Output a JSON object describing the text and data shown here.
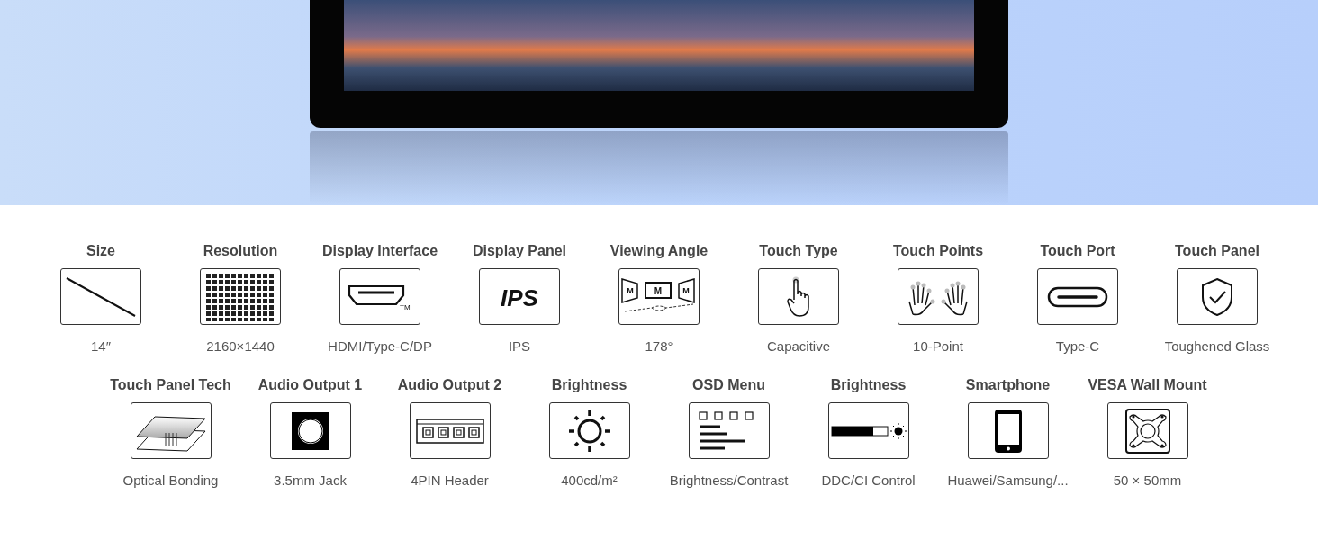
{
  "spec_rows": [
    [
      {
        "title": "Size",
        "value": "14″",
        "kind": "diagonal"
      },
      {
        "title": "Resolution",
        "value": "2160×1440",
        "kind": "pixel-grid"
      },
      {
        "title": "Display Interface",
        "value": "HDMI/Type-C/DP",
        "kind": "hdmi",
        "icon_text": "TM"
      },
      {
        "title": "Display Panel",
        "value": "IPS",
        "kind": "panel-text",
        "icon_text": "IPS"
      },
      {
        "title": "Viewing Angle",
        "value": "178°",
        "kind": "viewing",
        "icon_labels": [
          "M",
          "M",
          "M"
        ]
      },
      {
        "title": "Touch Type",
        "value": "Capacitive",
        "kind": "finger"
      },
      {
        "title": "Touch Points",
        "value": "10-Point",
        "kind": "hands"
      },
      {
        "title": "Touch Port",
        "value": "Type-C",
        "kind": "usbc"
      },
      {
        "title": "Touch Panel",
        "value": "Toughened Glass",
        "kind": "shield"
      }
    ],
    [
      {
        "title": "Touch Panel Tech",
        "value": "Optical Bonding",
        "kind": "layers"
      },
      {
        "title": "Audio Output 1",
        "value": "3.5mm Jack",
        "kind": "jack"
      },
      {
        "title": "Audio Output 2",
        "value": "4PIN Header",
        "kind": "header"
      },
      {
        "title": "Brightness",
        "value": "400cd/m²",
        "kind": "sun"
      },
      {
        "title": "OSD Menu",
        "value": "Brightness/Contrast",
        "kind": "osd"
      },
      {
        "title": "Brightness",
        "value": "DDC/CI Control",
        "kind": "slider-bar"
      },
      {
        "title": "Smartphone",
        "value": "Huawei/Samsung/...",
        "kind": "phone"
      },
      {
        "title": "VESA Wall Mount",
        "value": "50 × 50mm",
        "kind": "vesa"
      }
    ]
  ]
}
